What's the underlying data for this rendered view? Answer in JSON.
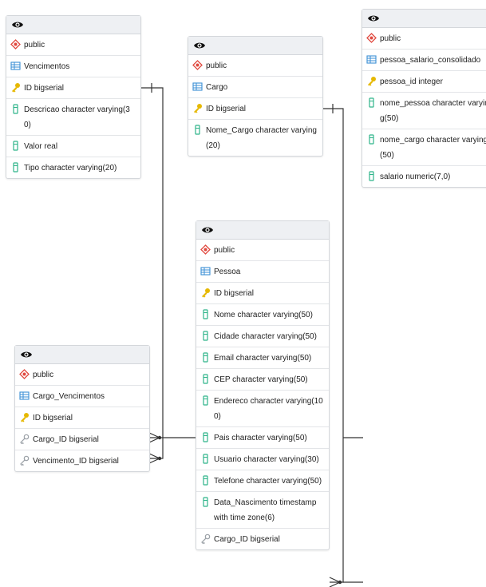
{
  "tables": [
    {
      "id": "vencimentos",
      "rows": [
        {
          "icon": "schema-icon",
          "text": "public"
        },
        {
          "icon": "table-icon",
          "text": "Vencimentos"
        },
        {
          "icon": "key-icon",
          "text": "ID bigserial"
        },
        {
          "icon": "column-icon",
          "text": "Descricao character varying(30)"
        },
        {
          "icon": "column-icon",
          "text": "Valor real"
        },
        {
          "icon": "column-icon",
          "text": "Tipo character varying(20)"
        }
      ]
    },
    {
      "id": "cargo",
      "rows": [
        {
          "icon": "schema-icon",
          "text": "public"
        },
        {
          "icon": "table-icon",
          "text": "Cargo"
        },
        {
          "icon": "key-icon",
          "text": "ID bigserial"
        },
        {
          "icon": "column-icon",
          "text": "Nome_Cargo character varying(20)"
        }
      ]
    },
    {
      "id": "pessoa_salario",
      "rows": [
        {
          "icon": "schema-icon",
          "text": "public"
        },
        {
          "icon": "table-icon",
          "text": "pessoa_salario_consolidado"
        },
        {
          "icon": "key-icon",
          "text": "pessoa_id integer"
        },
        {
          "icon": "column-icon",
          "text": "nome_pessoa character varying(50)"
        },
        {
          "icon": "column-icon",
          "text": "nome_cargo character varying(50)"
        },
        {
          "icon": "column-icon",
          "text": "salario numeric(7,0)"
        }
      ]
    },
    {
      "id": "pessoa",
      "rows": [
        {
          "icon": "schema-icon",
          "text": "public"
        },
        {
          "icon": "table-icon",
          "text": "Pessoa"
        },
        {
          "icon": "key-icon",
          "text": "ID bigserial"
        },
        {
          "icon": "column-icon",
          "text": "Nome character varying(50)"
        },
        {
          "icon": "column-icon",
          "text": "Cidade character varying(50)"
        },
        {
          "icon": "column-icon",
          "text": "Email character varying(50)"
        },
        {
          "icon": "column-icon",
          "text": "CEP character varying(50)"
        },
        {
          "icon": "column-icon",
          "text": "Endereco character varying(100)"
        },
        {
          "icon": "column-icon",
          "text": "Pais character varying(50)"
        },
        {
          "icon": "column-icon",
          "text": "Usuario character varying(30)"
        },
        {
          "icon": "column-icon",
          "text": "Telefone character varying(50)"
        },
        {
          "icon": "column-icon",
          "text": "Data_Nascimento timestamp with time zone(6)"
        },
        {
          "icon": "fkey-icon",
          "text": "Cargo_ID bigserial"
        }
      ]
    },
    {
      "id": "cargo_vencimentos",
      "rows": [
        {
          "icon": "schema-icon",
          "text": "public"
        },
        {
          "icon": "table-icon",
          "text": "Cargo_Vencimentos"
        },
        {
          "icon": "key-icon",
          "text": "ID bigserial"
        },
        {
          "icon": "fkey-icon",
          "text": "Cargo_ID bigserial"
        },
        {
          "icon": "fkey-icon",
          "text": "Vencimento_ID bigserial"
        }
      ]
    }
  ],
  "colors": {
    "key": "#e6b800",
    "column": "#2fb58a",
    "schema": "#e0483e",
    "table": "#3b8fd6",
    "fkey": "#9aa0a6",
    "line": "#333333"
  }
}
